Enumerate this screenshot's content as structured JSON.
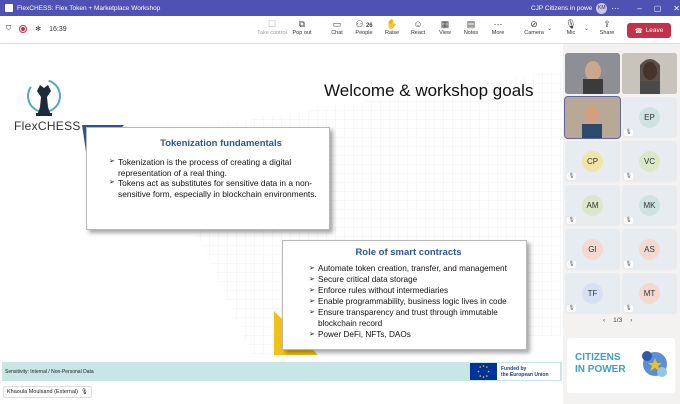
{
  "window": {
    "title": "FlexCHESS: Flex Token + Marketplace Workshop",
    "org": "CJP Citizens in powe",
    "avatar": "KM"
  },
  "toolbar": {
    "timer": "16:39",
    "buttons": {
      "take_control": "Take control",
      "pop_out": "Pop out",
      "chat": "Chat",
      "people": "People",
      "people_count": "26",
      "raise": "Raise",
      "react": "React",
      "view": "View",
      "notes": "Notes",
      "more": "More",
      "camera": "Camera",
      "mic": "Mic",
      "share": "Share",
      "leave": "Leave"
    }
  },
  "slide": {
    "logo_text": "FlexCHESS",
    "title": "Welcome & workshop goals",
    "box1": {
      "heading": "Tokenization fundamentals",
      "bullets": [
        "Tokenization is the process of creating a digital representation of a real thing.",
        "Tokens act as substitutes for sensitive data in a non-sensitive form, especially in blockchain environments."
      ]
    },
    "box2": {
      "heading": "Role of smart contracts",
      "bullets": [
        "Automate token creation, transfer, and management",
        "Secure critical data storage",
        "Enforce rules without intermediaries",
        "Enable programmability, business logic lives in code",
        "Ensure transparency and trust through immutable blockchain record",
        "Power DeFi, NFTs, DAOs"
      ]
    },
    "footer": {
      "sensitivity": "Sensitivity: Internal / Non-Personal Data",
      "eu_line1": "Funded by",
      "eu_line2": "the European Union"
    },
    "presenter": "Khaoula Moulsand (External)"
  },
  "participants": [
    {
      "initials": "",
      "video": true
    },
    {
      "initials": "",
      "video": true
    },
    {
      "initials": "",
      "video": true
    },
    {
      "initials": "EP",
      "color": "#cfe3e3"
    },
    {
      "initials": "CP",
      "color": "#f2e3a6"
    },
    {
      "initials": "VC",
      "color": "#d9e8c8"
    },
    {
      "initials": "AM",
      "color": "#d9e8c8"
    },
    {
      "initials": "MK",
      "color": "#cfe3e3"
    },
    {
      "initials": "GI",
      "color": "#f4d9d0"
    },
    {
      "initials": "AS",
      "color": "#f4d9d0"
    },
    {
      "initials": "TF",
      "color": "#d6e2f4"
    },
    {
      "initials": "MT",
      "color": "#f4d9d0"
    }
  ],
  "pager": "1/3",
  "brand_logo": "CITIZENS IN POWER"
}
